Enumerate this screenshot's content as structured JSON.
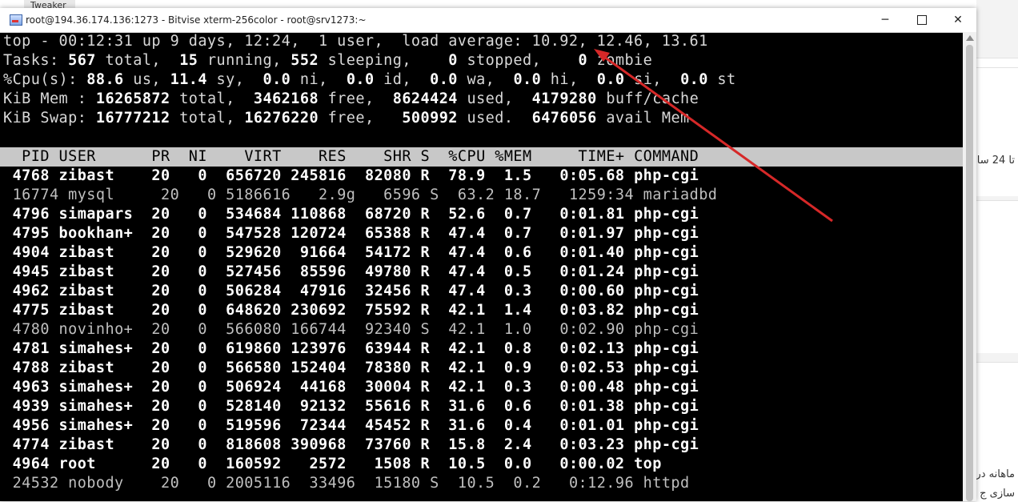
{
  "background": {
    "tab_label": "Tweaker",
    "right_texts": [
      "تا 24 سا",
      "ماهانه در",
      "سازی ج"
    ]
  },
  "window": {
    "title": "root@194.36.174.136:1273 - Bitvise xterm-256color - root@srv1273:~",
    "minimize": "─",
    "close": "✕",
    "icon": "terminal-app-icon"
  },
  "top": {
    "summary": {
      "prefix": "top - 00:12:31 up 9 days, 12:24,  1 user,  load average: 10.92, 12.46, 13.61",
      "tasks": [
        "Tasks: ",
        "567",
        " total, ",
        " 15",
        " running, ",
        "552",
        " sleeping,  ",
        "  0",
        " stopped,  ",
        "  0",
        " zombie"
      ],
      "cpu": [
        "%Cpu(s): ",
        "88.6",
        " us, ",
        "11.4",
        " sy, ",
        " 0.0",
        " ni, ",
        " 0.0",
        " id, ",
        " 0.0",
        " wa, ",
        " 0.0",
        " hi, ",
        " 0.0",
        " si, ",
        " 0.0",
        " st"
      ],
      "mem": [
        "KiB Mem : ",
        "16265872",
        " total, ",
        " 3462168",
        " free, ",
        " 8624424",
        " used, ",
        " 4179280",
        " buff/cache"
      ],
      "swap": [
        "KiB Swap: ",
        "16777212",
        " total, ",
        "16276220",
        " free, ",
        "  500992",
        " used. ",
        " 6476056",
        " avail Mem"
      ]
    },
    "columns": [
      "PID",
      "USER",
      "PR",
      "NI",
      "VIRT",
      "RES",
      "SHR",
      "S",
      "%CPU",
      "%MEM",
      "TIME+",
      "COMMAND"
    ],
    "processes": [
      {
        "pid": "4768",
        "user": "zibast",
        "pr": "20",
        "ni": "0",
        "virt": "656720",
        "res": "245816",
        "shr": "82080",
        "s": "R",
        "cpu": "78.9",
        "mem": "1.5",
        "time": "0:05.68",
        "cmd": "php-cgi",
        "running": true
      },
      {
        "pid": "16774",
        "user": "mysql",
        "pr": "20",
        "ni": "0",
        "virt": "5186616",
        "res": "2.9g",
        "shr": "6596",
        "s": "S",
        "cpu": "63.2",
        "mem": "18.7",
        "time": "1259:34",
        "cmd": "mariadbd",
        "running": false
      },
      {
        "pid": "4796",
        "user": "simapars",
        "pr": "20",
        "ni": "0",
        "virt": "534684",
        "res": "110868",
        "shr": "68720",
        "s": "R",
        "cpu": "52.6",
        "mem": "0.7",
        "time": "0:01.81",
        "cmd": "php-cgi",
        "running": true
      },
      {
        "pid": "4795",
        "user": "bookhan+",
        "pr": "20",
        "ni": "0",
        "virt": "547528",
        "res": "120724",
        "shr": "65388",
        "s": "R",
        "cpu": "47.4",
        "mem": "0.7",
        "time": "0:01.97",
        "cmd": "php-cgi",
        "running": true
      },
      {
        "pid": "4904",
        "user": "zibast",
        "pr": "20",
        "ni": "0",
        "virt": "529620",
        "res": "91664",
        "shr": "54172",
        "s": "R",
        "cpu": "47.4",
        "mem": "0.6",
        "time": "0:01.40",
        "cmd": "php-cgi",
        "running": true
      },
      {
        "pid": "4945",
        "user": "zibast",
        "pr": "20",
        "ni": "0",
        "virt": "527456",
        "res": "85596",
        "shr": "49780",
        "s": "R",
        "cpu": "47.4",
        "mem": "0.5",
        "time": "0:01.24",
        "cmd": "php-cgi",
        "running": true
      },
      {
        "pid": "4962",
        "user": "zibast",
        "pr": "20",
        "ni": "0",
        "virt": "506284",
        "res": "47916",
        "shr": "32456",
        "s": "R",
        "cpu": "47.4",
        "mem": "0.3",
        "time": "0:00.60",
        "cmd": "php-cgi",
        "running": true
      },
      {
        "pid": "4775",
        "user": "zibast",
        "pr": "20",
        "ni": "0",
        "virt": "648620",
        "res": "230692",
        "shr": "75592",
        "s": "R",
        "cpu": "42.1",
        "mem": "1.4",
        "time": "0:03.82",
        "cmd": "php-cgi",
        "running": true
      },
      {
        "pid": "4780",
        "user": "novinho+",
        "pr": "20",
        "ni": "0",
        "virt": "566080",
        "res": "166744",
        "shr": "92340",
        "s": "S",
        "cpu": "42.1",
        "mem": "1.0",
        "time": "0:02.90",
        "cmd": "php-cgi",
        "running": false
      },
      {
        "pid": "4781",
        "user": "simahes+",
        "pr": "20",
        "ni": "0",
        "virt": "619860",
        "res": "123976",
        "shr": "63944",
        "s": "R",
        "cpu": "42.1",
        "mem": "0.8",
        "time": "0:02.13",
        "cmd": "php-cgi",
        "running": true
      },
      {
        "pid": "4788",
        "user": "zibast",
        "pr": "20",
        "ni": "0",
        "virt": "566580",
        "res": "152404",
        "shr": "78380",
        "s": "R",
        "cpu": "42.1",
        "mem": "0.9",
        "time": "0:02.53",
        "cmd": "php-cgi",
        "running": true
      },
      {
        "pid": "4963",
        "user": "simahes+",
        "pr": "20",
        "ni": "0",
        "virt": "506924",
        "res": "44168",
        "shr": "30004",
        "s": "R",
        "cpu": "42.1",
        "mem": "0.3",
        "time": "0:00.48",
        "cmd": "php-cgi",
        "running": true
      },
      {
        "pid": "4939",
        "user": "simahes+",
        "pr": "20",
        "ni": "0",
        "virt": "528140",
        "res": "92132",
        "shr": "55616",
        "s": "R",
        "cpu": "31.6",
        "mem": "0.6",
        "time": "0:01.38",
        "cmd": "php-cgi",
        "running": true
      },
      {
        "pid": "4956",
        "user": "simahes+",
        "pr": "20",
        "ni": "0",
        "virt": "519596",
        "res": "72344",
        "shr": "45452",
        "s": "R",
        "cpu": "31.6",
        "mem": "0.4",
        "time": "0:01.01",
        "cmd": "php-cgi",
        "running": true
      },
      {
        "pid": "4774",
        "user": "zibast",
        "pr": "20",
        "ni": "0",
        "virt": "818608",
        "res": "390968",
        "shr": "73760",
        "s": "R",
        "cpu": "15.8",
        "mem": "2.4",
        "time": "0:03.23",
        "cmd": "php-cgi",
        "running": true
      },
      {
        "pid": "4964",
        "user": "root",
        "pr": "20",
        "ni": "0",
        "virt": "160592",
        "res": "2572",
        "shr": "1508",
        "s": "R",
        "cpu": "10.5",
        "mem": "0.0",
        "time": "0:00.02",
        "cmd": "top",
        "running": true
      },
      {
        "pid": "24532",
        "user": "nobody",
        "pr": "20",
        "ni": "0",
        "virt": "2005116",
        "res": "33496",
        "shr": "15180",
        "s": "S",
        "cpu": "10.5",
        "mem": "0.2",
        "time": "0:12.96",
        "cmd": "httpd",
        "running": false
      }
    ]
  },
  "colors": {
    "terminal_bg": "#000000",
    "terminal_fg": "#d8d8d8",
    "header_bg": "#c8c8c8",
    "annotation_arrow": "#d62828"
  }
}
